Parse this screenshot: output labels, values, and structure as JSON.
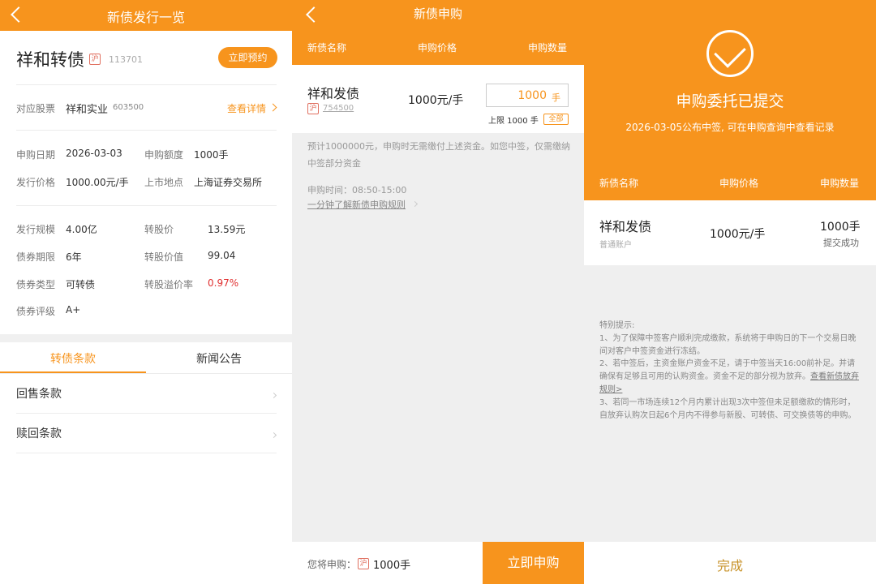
{
  "screen1": {
    "title": "新债发行一览",
    "bond_name": "祥和转债",
    "exchange_badge": "沪",
    "bond_code": "113701",
    "reserve_button": "立即预约",
    "stock_label": "对应股票",
    "stock_name": "祥和实业",
    "stock_code": "603500",
    "detail_link": "查看详情",
    "rows1": [
      {
        "l1": "申购日期",
        "v1": "2026-03-03",
        "l2": "申购额度",
        "v2": "1000手"
      },
      {
        "l1": "发行价格",
        "v1": "1000.00元/手",
        "l2": "上市地点",
        "v2": "上海证券交易所"
      }
    ],
    "rows2": [
      {
        "l1": "发行规模",
        "v1": "4.00亿",
        "l2": "转股价",
        "v2": "13.59元"
      },
      {
        "l1": "债券期限",
        "v1": "6年",
        "l2": "转股价值",
        "v2": "99.04"
      },
      {
        "l1": "债券类型",
        "v1": "可转债",
        "l2": "转股溢价率",
        "v2": "0.97%"
      },
      {
        "l1": "债券评级",
        "v1": "A+"
      }
    ],
    "tabs": [
      "转债条款",
      "新闻公告"
    ],
    "list_items": [
      "回售条款",
      "赎回条款"
    ]
  },
  "screen2": {
    "title": "新债申购",
    "columns": [
      "新债名称",
      "申购价格",
      "申购数量"
    ],
    "bond_name": "祥和发债",
    "exchange_badge": "沪",
    "bond_code": "754500",
    "price": "1000元/手",
    "quantity": "1000",
    "quantity_unit": "手",
    "limit": "上限 1000 手",
    "all_button": "全部",
    "note": "预计1000000元，申购时无需缴付上述资金。如您中签，仅需缴纳中签部分资金",
    "time": "申购时间：08:50-15:00",
    "rule_link": "一分钟了解新债申购规则",
    "will_buy_label": "您将申购：",
    "will_buy_qty": "1000手",
    "submit_button": "立即申购"
  },
  "screen3": {
    "status_title": "申购委托已提交",
    "publish_note": "2026-03-05公布中签, 可在申购查询中查看记录",
    "columns": [
      "新债名称",
      "申购价格",
      "申购数量"
    ],
    "bond_name": "祥和发债",
    "account": "普通账户",
    "price": "1000元/手",
    "quantity": "1000手",
    "status": "提交成功",
    "tips_title": "特别提示:",
    "tip1": "1、为了保障中签客户顺利完成缴款，系统将于申购日的下一个交易日晚间对客户中签资金进行冻结。",
    "tip2_prefix": "2、若中签后，主资金账户资金不足，请于中签当天16:00前补足。并请确保有足够且可用的认购资金。资金不足的部分视为放弃。",
    "tip2_link": "查看新债放弃规则>",
    "tip3": "3、若同一市场连续12个月内累计出现3次中签但未足额缴款的情形时，自放弃认购次日起6个月内不得参与新股、可转债、可交换债等的申购。",
    "done_button": "完成"
  },
  "colors": {
    "brand_orange": "#f7941d",
    "negative_red": "#e03030",
    "done_gold": "#c8932a"
  }
}
